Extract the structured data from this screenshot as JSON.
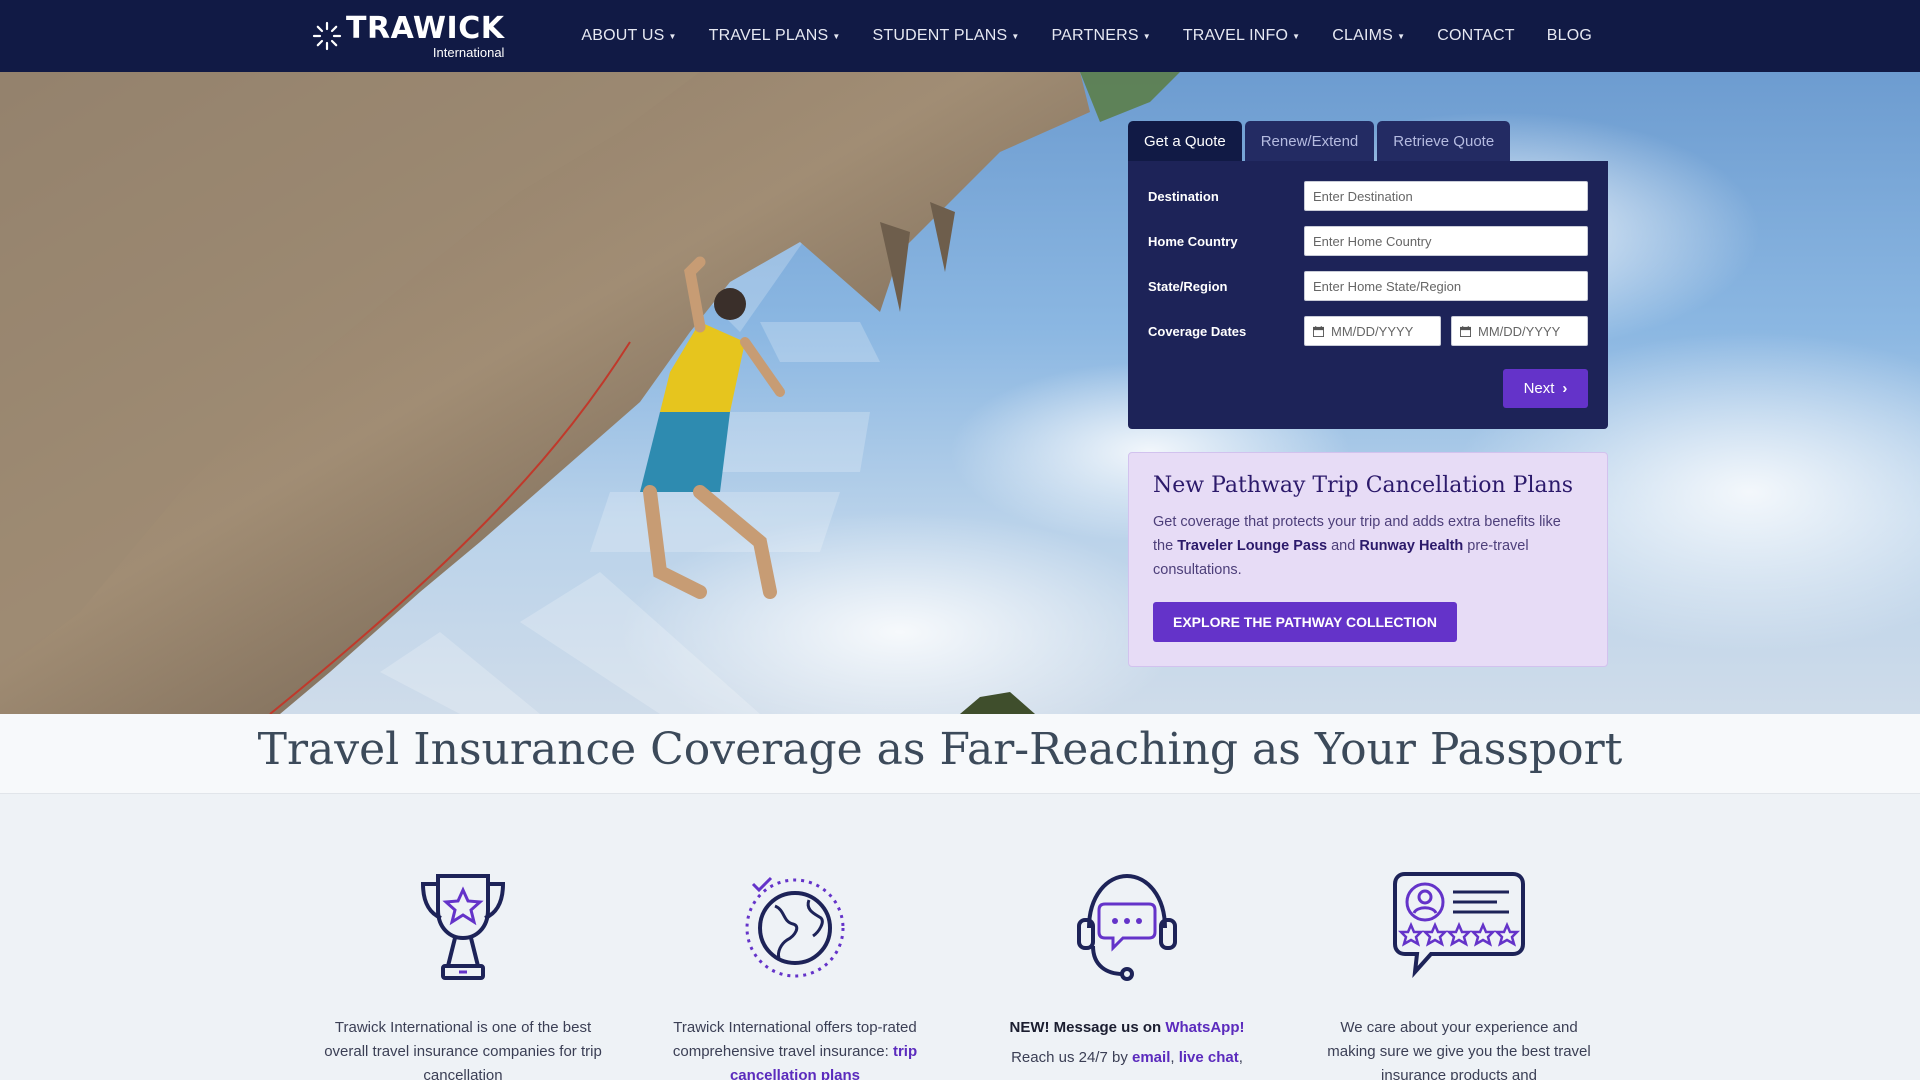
{
  "brand": {
    "name": "TRAWICK",
    "sub": "International"
  },
  "nav": {
    "items": [
      {
        "label": "ABOUT US",
        "dropdown": true
      },
      {
        "label": "TRAVEL PLANS",
        "dropdown": true
      },
      {
        "label": "STUDENT PLANS",
        "dropdown": true
      },
      {
        "label": "PARTNERS",
        "dropdown": true
      },
      {
        "label": "TRAVEL INFO",
        "dropdown": true
      },
      {
        "label": "CLAIMS",
        "dropdown": true
      },
      {
        "label": "CONTACT",
        "dropdown": false
      },
      {
        "label": "BLOG",
        "dropdown": false
      }
    ]
  },
  "quote": {
    "tabs": [
      "Get a Quote",
      "Renew/Extend",
      "Retrieve Quote"
    ],
    "active_tab": "Get a Quote",
    "fields": [
      {
        "label": "Destination",
        "placeholder": "Enter Destination"
      },
      {
        "label": "Home Country",
        "placeholder": "Enter Home Country"
      },
      {
        "label": "State/Region",
        "placeholder": "Enter Home State/Region"
      }
    ],
    "coverage": {
      "label": "Coverage Dates",
      "start_placeholder": "MM/DD/YYYY",
      "end_placeholder": "MM/DD/YYYY"
    },
    "next_label": "Next"
  },
  "promo": {
    "title": "New Pathway Trip Cancellation Plans",
    "body_1": "Get coverage that protects your trip and adds extra benefits like the ",
    "bold_1": "Traveler Lounge Pass",
    "body_2": " and ",
    "bold_2": "Runway Health",
    "body_3": " pre-travel consultations.",
    "button": "EXPLORE THE PATHWAY COLLECTION"
  },
  "headline": "Travel Insurance Coverage as Far-Reaching as Your Passport",
  "features": [
    {
      "icon": "trophy-icon",
      "text": "Trawick International is one of the best overall travel insurance companies for trip cancellation"
    },
    {
      "icon": "globe-icon",
      "text_1": "Trawick International offers top-rated comprehensive travel insurance: ",
      "link": "trip cancellation plans"
    },
    {
      "icon": "headset-chat-icon",
      "bold": "NEW! Message us on ",
      "link_1": "WhatsApp!",
      "text_1": "Reach us 24/7 by ",
      "link_2": "email",
      "sep": ", ",
      "link_3": "live chat",
      "tail": ","
    },
    {
      "icon": "review-stars-icon",
      "text": "We care about your experience and making sure we give you the best travel insurance products and"
    }
  ],
  "colors": {
    "navy": "#111a45",
    "card": "#1d2358",
    "purple": "#6433c9",
    "promo_bg": "#e7dcf6"
  }
}
